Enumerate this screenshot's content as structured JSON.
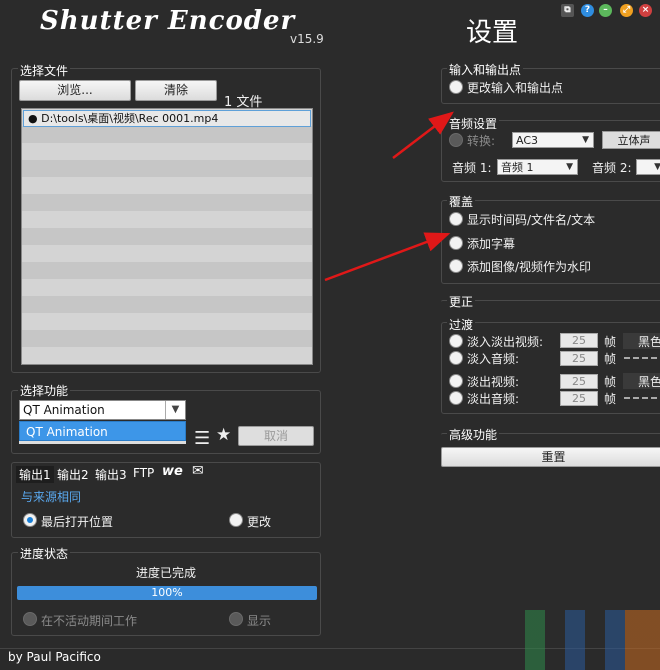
{
  "app": {
    "title": "Shutter Encoder",
    "version": "v15.9",
    "settings_title": "设置",
    "footer": "by Paul Pacifico"
  },
  "files": {
    "group_label": "选择文件",
    "browse_label": "浏览...",
    "clear_label": "清除",
    "count": "1 文件",
    "items": [
      "D:\\tools\\桌面\\视频\\Rec 0001.mp4"
    ]
  },
  "function": {
    "group_label": "选择功能",
    "selected": "QT Animation",
    "dropdown_option": "QT Animation",
    "cancel_label": "取消"
  },
  "output": {
    "tabs": [
      "输出1",
      "输出2",
      "输出3",
      "FTP"
    ],
    "source_label": "与来源相同",
    "last_open_label": "最后打开位置",
    "change_label": "更改"
  },
  "progress": {
    "group_label": "进度状态",
    "status": "进度已完成",
    "percent_text": "100%",
    "percent": 100,
    "idle_label": "在不活动期间工作",
    "show_label": "显示"
  },
  "inout": {
    "group_label": "输入和输出点",
    "change_label": "更改输入和输出点"
  },
  "audio": {
    "group_label": "音频设置",
    "convert_label": "转换:",
    "codec": "AC3",
    "stereo_label": "立体声",
    "audio1_label": "音频 1:",
    "audio1_value": "音频 1",
    "audio2_label": "音频 2:"
  },
  "overlay": {
    "group_label": "覆盖",
    "timecode_label": "显示时间码/文件名/文本",
    "subtitles_label": "添加字幕",
    "watermark_label": "添加图像/视频作为水印"
  },
  "correction": {
    "group_label": "更正"
  },
  "transition": {
    "group_label": "过渡",
    "fade_in_video": "淡入淡出视频:",
    "fade_in_audio": "淡入音频:",
    "fade_out_video": "淡出视频:",
    "fade_out_audio": "淡出音频:",
    "frames_value": "25",
    "frames_unit": "帧",
    "black_label": "黑色"
  },
  "advanced": {
    "group_label": "高级功能",
    "reset_label": "重置"
  },
  "colors": {
    "background": "#2b2b2b",
    "accent": "#3d8edb",
    "arrow": "#e01818"
  }
}
